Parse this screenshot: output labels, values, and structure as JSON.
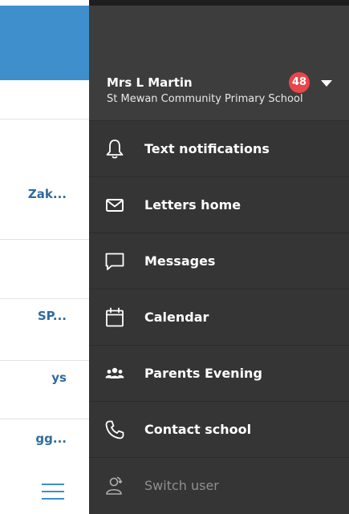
{
  "background": {
    "list_snippets": [
      "Zak...",
      "SP...",
      "ys",
      "gg..."
    ]
  },
  "account": {
    "name": "Mrs L Martin",
    "school": "St Mewan Community Primary School",
    "notification_count": "48"
  },
  "menu": {
    "items": [
      {
        "label": "Text notifications",
        "icon": "bell-icon"
      },
      {
        "label": "Letters home",
        "icon": "envelope-icon"
      },
      {
        "label": "Messages",
        "icon": "chat-bubble-icon"
      },
      {
        "label": "Calendar",
        "icon": "calendar-icon"
      },
      {
        "label": "Parents Evening",
        "icon": "people-icon"
      },
      {
        "label": "Contact school",
        "icon": "phone-icon"
      },
      {
        "label": "Switch user",
        "icon": "switch-user-icon"
      }
    ]
  },
  "colors": {
    "accent": "#3e8fcc",
    "drawer": "#353535",
    "badge": "#e8464a",
    "link_text": "#2f6b9e"
  }
}
